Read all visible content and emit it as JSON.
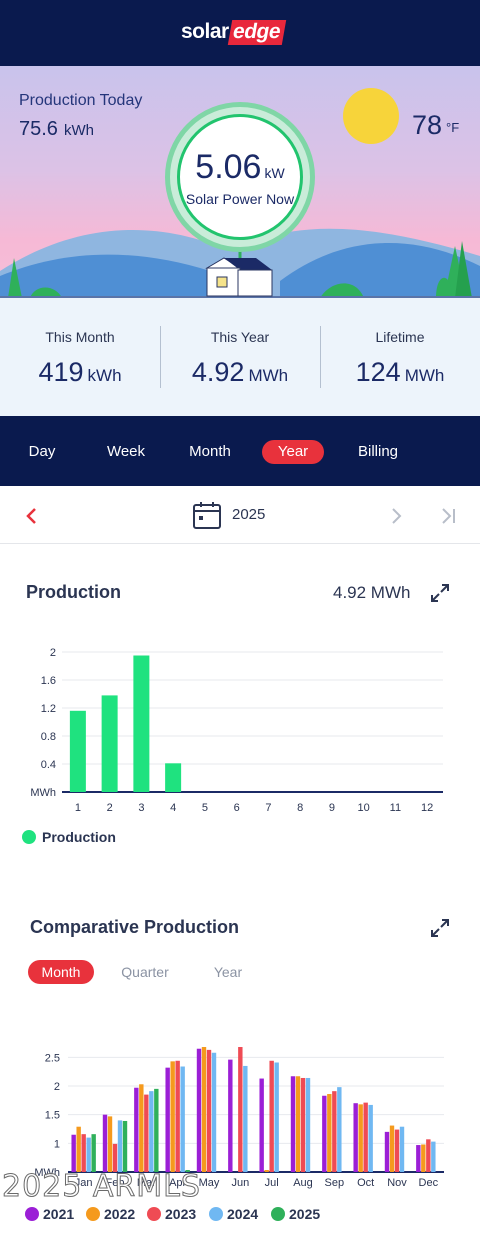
{
  "header": {
    "logo_word": "solar",
    "logo_accent": "edge"
  },
  "hero": {
    "production_today_label": "Production Today",
    "production_today_value": "75.6",
    "production_today_unit": "kWh",
    "solar_power_value": "5.06",
    "solar_power_unit": "kW",
    "solar_power_label": "Solar Power Now",
    "temperature_value": "78",
    "temperature_unit": "°F"
  },
  "stats": [
    {
      "label": "This Month",
      "value": "419",
      "unit": "kWh"
    },
    {
      "label": "This Year",
      "value": "4.92",
      "unit": "MWh"
    },
    {
      "label": "Lifetime",
      "value": "124",
      "unit": "MWh"
    }
  ],
  "tabs": [
    "Day",
    "Week",
    "Month",
    "Year",
    "Billing"
  ],
  "active_tab": "Year",
  "date_nav": {
    "label": "2025"
  },
  "production": {
    "title": "Production",
    "total": "4.92 MWh",
    "legend": "Production"
  },
  "comparative": {
    "title": "Comparative Production",
    "subtabs": [
      "Month",
      "Quarter",
      "Year"
    ],
    "active_subtab": "Month"
  },
  "watermark": "2025 ARMLS",
  "colors": {
    "navy": "#0a1a4e",
    "accent_red": "#e8323c",
    "production_green": "#1fe27f",
    "y2021": "#9b1fd6",
    "y2022": "#f59a1d",
    "y2023": "#ef4b54",
    "y2024": "#70b8f2",
    "y2025": "#2fb05a"
  },
  "chart_data": [
    {
      "type": "bar",
      "title": "Production",
      "ylabel": "MWh",
      "ylim": [
        0,
        2
      ],
      "yticks": [
        "MWh",
        "0.4",
        "0.8",
        "1.2",
        "1.6",
        "2"
      ],
      "categories": [
        "1",
        "2",
        "3",
        "4",
        "5",
        "6",
        "7",
        "8",
        "9",
        "10",
        "11",
        "12"
      ],
      "series": [
        {
          "name": "Production",
          "values": [
            1.16,
            1.38,
            1.95,
            0.41,
            0,
            0,
            0,
            0,
            0,
            0,
            0,
            0
          ]
        }
      ],
      "grid": true,
      "legend": "bottom-left"
    },
    {
      "type": "bar",
      "title": "Comparative Production",
      "ylabel": "MWh",
      "ylim": [
        0,
        2.75
      ],
      "yticks": [
        "MWh",
        "1",
        "1.5",
        "2",
        "2.5"
      ],
      "categories": [
        "Jan",
        "Feb",
        "Mar",
        "Apr",
        "May",
        "Jun",
        "Jul",
        "Aug",
        "Sep",
        "Oct",
        "Nov",
        "Dec"
      ],
      "series": [
        {
          "name": "2021",
          "values": [
            1.15,
            1.5,
            1.97,
            2.32,
            2.65,
            2.46,
            2.13,
            2.17,
            1.83,
            1.7,
            1.2,
            0.97
          ]
        },
        {
          "name": "2022",
          "values": [
            1.29,
            1.47,
            2.03,
            2.43,
            2.68,
            0,
            0.09,
            2.17,
            1.86,
            1.68,
            1.31,
            0.98
          ]
        },
        {
          "name": "2023",
          "values": [
            1.16,
            0.99,
            1.85,
            2.44,
            2.63,
            2.68,
            2.44,
            2.14,
            1.91,
            1.71,
            1.24,
            1.07
          ]
        },
        {
          "name": "2024",
          "values": [
            1.1,
            1.4,
            1.91,
            2.34,
            2.58,
            2.35,
            2.41,
            2.14,
            1.98,
            1.67,
            1.29,
            1.03
          ]
        },
        {
          "name": "2025",
          "values": [
            1.16,
            1.39,
            1.95,
            0.41,
            0,
            0,
            0,
            0,
            0,
            0,
            0,
            0
          ]
        }
      ],
      "grid": true,
      "legend": "bottom"
    }
  ]
}
